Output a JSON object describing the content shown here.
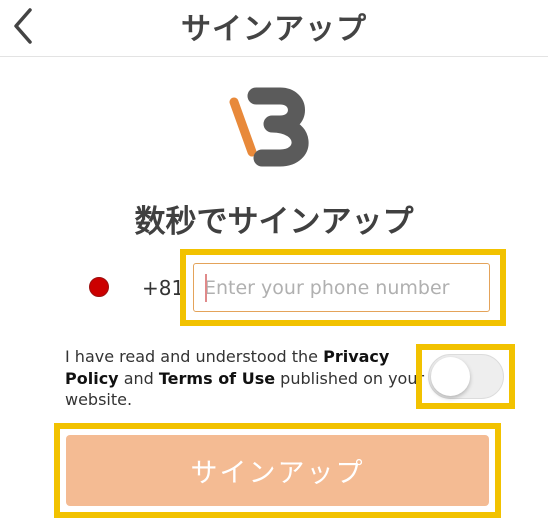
{
  "header": {
    "title": "サインアップ",
    "back_icon": "chevron-left-icon"
  },
  "logo": {
    "name": "B-logo",
    "colors": {
      "orange": "#e8893a",
      "gray": "#5b5b5b"
    }
  },
  "headline": "数秒でサインアップ",
  "phone": {
    "flag": "japan-flag-icon",
    "country_code": "+81",
    "placeholder": "Enter your phone number",
    "value": ""
  },
  "terms": {
    "text_1": "I have read and understood the ",
    "privacy_label": "Privacy Policy",
    "text_2": " and ",
    "terms_label": "Terms of Use",
    "text_3": " published on your website.",
    "toggle_on": false
  },
  "signup_button": {
    "label": "サインアップ"
  },
  "colors": {
    "accent": "#f4bb93",
    "input_border": "#e4a35a",
    "highlight": "#f2c200",
    "flag_red": "#cc0000"
  }
}
